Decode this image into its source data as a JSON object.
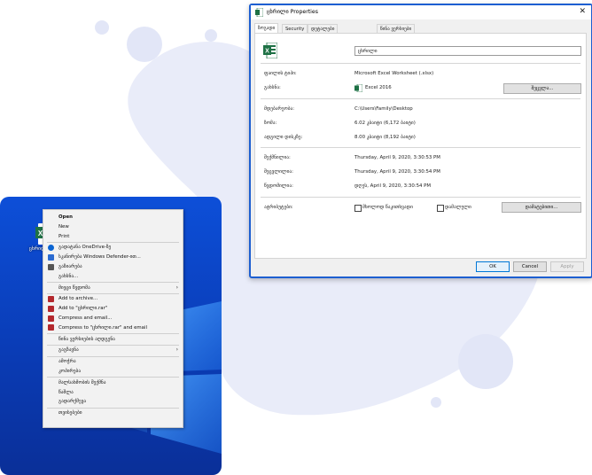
{
  "colors": {
    "blob": "#e9ecf9",
    "desktop": "#0a3cb6",
    "excel_green": "#1e7145",
    "window_border": "#1d5fd1"
  },
  "desktop": {
    "icon": {
      "name": "excel-file-icon",
      "label": "ცხრილი.xlsx"
    }
  },
  "context_menu": {
    "items": [
      {
        "label": "Open",
        "bold": true,
        "icon": ""
      },
      {
        "label": "New",
        "bold": false,
        "icon": ""
      },
      {
        "label": "Print",
        "bold": false,
        "icon": ""
      },
      {
        "label": "გადატანა OneDrive-ზე",
        "bold": false,
        "icon": "onedrive-icon"
      },
      {
        "label": "სკანირება Windows Defender-ით...",
        "bold": false,
        "icon": "defender-icon"
      },
      {
        "label": "გაზიარება",
        "bold": false,
        "icon": "share-icon"
      },
      {
        "label": "გახსნა...",
        "bold": false,
        "icon": ""
      },
      {
        "label": "მიეცი წვდომა",
        "bold": false,
        "icon": "",
        "submenu": true
      },
      {
        "label": "Add to archive...",
        "bold": false,
        "icon": "winrar-icon"
      },
      {
        "label": "Add to \"ცხრილი.rar\"",
        "bold": false,
        "icon": "winrar-icon"
      },
      {
        "label": "Compress and email...",
        "bold": false,
        "icon": "winrar-icon"
      },
      {
        "label": "Compress to \"ცხრილი.rar\" and email",
        "bold": false,
        "icon": "winrar-icon"
      },
      {
        "label": "წინა ვერსიების აღდგენა",
        "bold": false,
        "icon": ""
      },
      {
        "label": "გაგზავნა",
        "bold": false,
        "icon": "",
        "submenu": true
      },
      {
        "label": "ამოჭრა",
        "bold": false,
        "icon": ""
      },
      {
        "label": "კოპირება",
        "bold": false,
        "icon": ""
      },
      {
        "label": "მალსახმობის შექმნა",
        "bold": false,
        "icon": ""
      },
      {
        "label": "წაშლა",
        "bold": false,
        "icon": ""
      },
      {
        "label": "გადარქმევა",
        "bold": false,
        "icon": ""
      },
      {
        "label": "თვისებები",
        "bold": false,
        "icon": ""
      }
    ]
  },
  "properties": {
    "title": "ცხრილი Properties",
    "close_label": "✕",
    "tabs": [
      "ზოგადი",
      "Security",
      "დეტალები",
      "წინა ვერსიები"
    ],
    "file_name": "ცხრილი",
    "rows": {
      "type_label": "ფაილის ტიპი:",
      "type_value": "Microsoft Excel Worksheet (.xlsx)",
      "opens_label": "გახსნა:",
      "opens_value": "Excel 2016",
      "change_button": "შეცვლა...",
      "location_label": "მდებარეობა:",
      "location_value": "C:\\Users\\Family\\Desktop",
      "size_label": "ზომა:",
      "size_value": "6.02 კბაიტი (6,172 ბაიტი)",
      "disk_label": "ადგილი დისკზე:",
      "disk_value": "8.00 კბაიტი (8,192 ბაიტი)",
      "created_label": "შექმნილია:",
      "created_value": "Thursday, April 9, 2020, 3:30:53 PM",
      "modified_label": "შეცვლილია:",
      "modified_value": "Thursday, April 9, 2020, 3:30:54 PM",
      "accessed_label": "წვდომილია:",
      "accessed_value": "დღეს, April 9, 2020, 3:30:54 PM",
      "attributes_label": "ატრიბუტები:",
      "readonly_label": "მხოლოდ წაკითხვადი",
      "hidden_label": "დამალული",
      "advanced_button": "დამატებითი..."
    },
    "buttons": {
      "ok": "OK",
      "cancel": "Cancel",
      "apply": "Apply"
    }
  }
}
